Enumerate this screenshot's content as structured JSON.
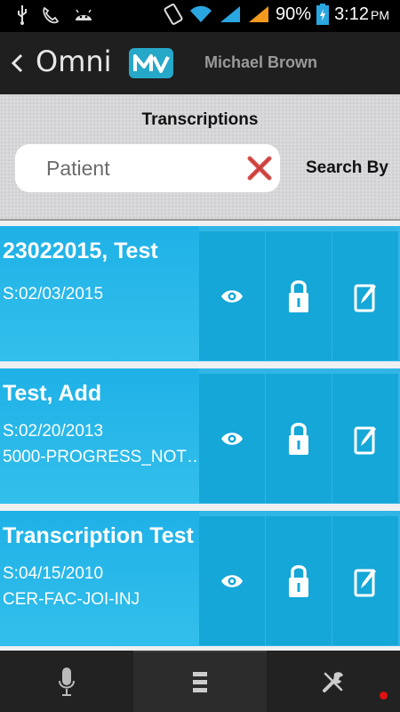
{
  "status_bar": {
    "battery_pct": "90%",
    "time": "3:12",
    "ampm": "PM",
    "icons": [
      "usb-icon",
      "phone-icon",
      "android-icon",
      "vibrate-icon",
      "wifi-icon",
      "signal-icon",
      "signal-icon",
      "battery-icon"
    ]
  },
  "header": {
    "brand_text": "Omni",
    "brand_badge_icon": "mv-logo-icon",
    "user_name": "Michael Brown"
  },
  "search": {
    "title": "Transcriptions",
    "placeholder": "Patient",
    "value": "",
    "search_by_label": "Search By"
  },
  "colors": {
    "accent": "#26a8c8",
    "card": "#2cb7e6",
    "action": "#15a7d7",
    "clear_x": "#d9534f"
  },
  "transcriptions": [
    {
      "title": "23022015, Test",
      "date": "S:02/03/2015",
      "note": ""
    },
    {
      "title": "Test, Add",
      "date": "S:02/20/2013",
      "note": "5000-PROGRESS_NOT…"
    },
    {
      "title": "Transcription Test",
      "date": "S:04/15/2010",
      "note": "CER-FAC-JOI-INJ"
    }
  ],
  "actions": [
    "eye-icon",
    "lock-icon",
    "edit-icon"
  ],
  "bottom_nav": [
    "microphone-icon",
    "list-icon",
    "tools-icon"
  ]
}
